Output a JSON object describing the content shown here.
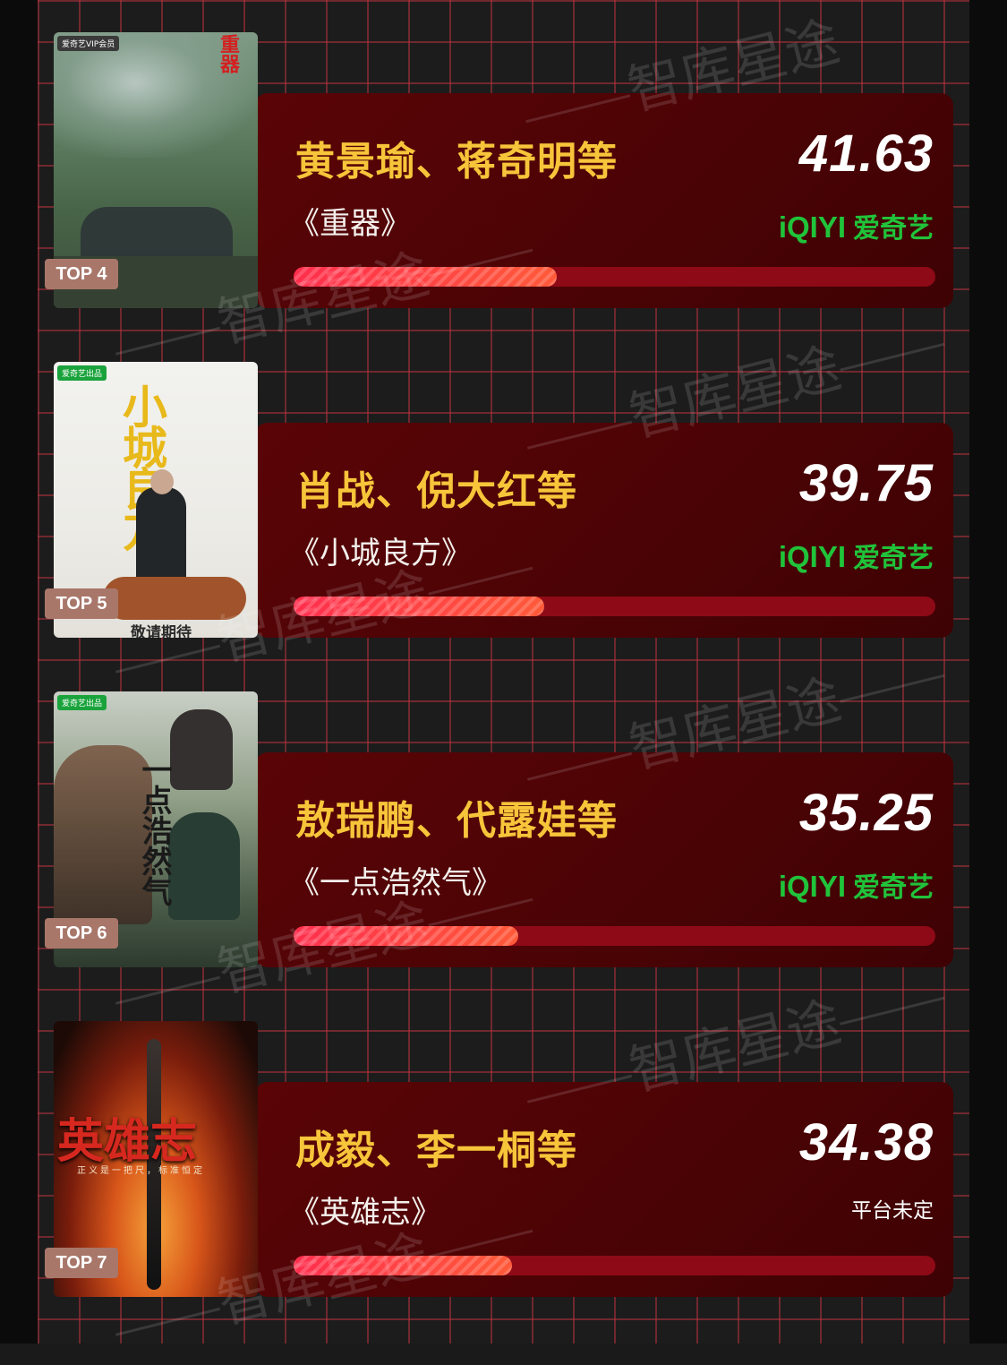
{
  "watermark": "智库星途",
  "entries": [
    {
      "rank": "TOP 4",
      "actors": "黄景瑜、蒋奇明等",
      "title": "《重器》",
      "score": "41.63",
      "platform_latin": "iQIYI",
      "platform_cn": "爱奇艺",
      "progress": 0.41,
      "poster": {
        "tag": "爱奇艺VIP会员",
        "caption": "重器"
      }
    },
    {
      "rank": "TOP 5",
      "actors": "肖战、倪大红等",
      "title": "《小城良方》",
      "score": "39.75",
      "platform_latin": "iQIYI",
      "platform_cn": "爱奇艺",
      "progress": 0.39,
      "poster": {
        "tag": "爱奇艺出品",
        "caption": "小城良方",
        "footer": "敬请期待"
      }
    },
    {
      "rank": "TOP 6",
      "actors": "敖瑞鹏、代露娃等",
      "title": "《一点浩然气》",
      "score": "35.25",
      "platform_latin": "iQIYI",
      "platform_cn": "爱奇艺",
      "progress": 0.35,
      "poster": {
        "tag": "爱奇艺出品",
        "caption": "一点浩然气"
      }
    },
    {
      "rank": "TOP 7",
      "actors": "成毅、李一桐等",
      "title": "《英雄志》",
      "score": "34.38",
      "platform_text": "平台未定",
      "progress": 0.34,
      "poster": {
        "caption": "英雄志",
        "subline": "正义是一把尺，标准恒定"
      }
    }
  ],
  "colors": {
    "card": "#4a0305",
    "name": "#f7c53a",
    "iqiyi": "#20c33a",
    "bar_track": "#8e0a16",
    "bar_fill": "#ff2e4d",
    "badge": "#a8776a"
  }
}
